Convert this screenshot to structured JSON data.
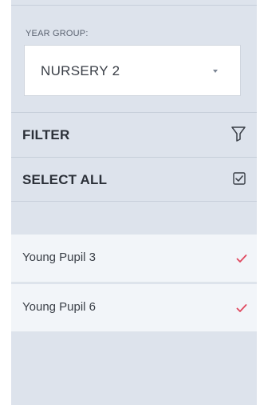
{
  "year_group": {
    "label": "YEAR GROUP:",
    "selected": "NURSERY 2"
  },
  "filter": {
    "label": "FILTER",
    "icon": "filter-icon"
  },
  "select_all": {
    "label": "SELECT ALL",
    "icon": "checkbox-checked-icon"
  },
  "pupils": [
    {
      "name": "Young Pupil 3",
      "selected": true
    },
    {
      "name": "Young Pupil 6",
      "selected": true
    }
  ],
  "colors": {
    "panel_bg": "#dde3ec",
    "row_bg": "#f2f5f9",
    "tick": "#e0485f"
  }
}
